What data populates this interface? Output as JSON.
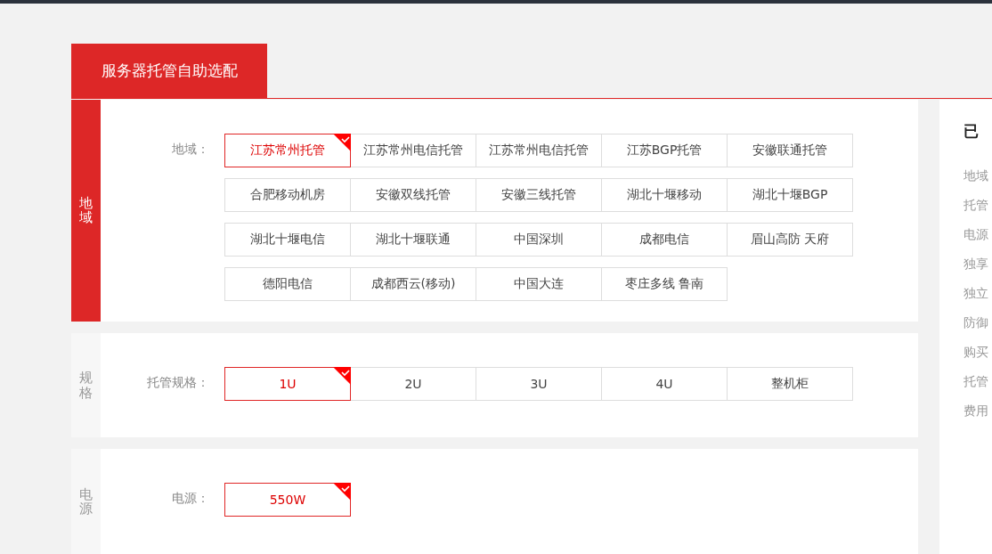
{
  "header": {
    "title": "服务器托管自助选配"
  },
  "sections": [
    {
      "name": "地域",
      "active": true,
      "label": "地域：",
      "options": [
        {
          "label": "江苏常州托管",
          "selected": true
        },
        {
          "label": "江苏常州电信托管",
          "selected": false
        },
        {
          "label": "江苏常州电信托管",
          "selected": false
        },
        {
          "label": "江苏BGP托管",
          "selected": false
        },
        {
          "label": "安徽联通托管",
          "selected": false
        },
        {
          "label": "合肥移动机房",
          "selected": false
        },
        {
          "label": "安徽双线托管",
          "selected": false
        },
        {
          "label": "安徽三线托管",
          "selected": false
        },
        {
          "label": "湖北十堰移动",
          "selected": false
        },
        {
          "label": "湖北十堰BGP",
          "selected": false
        },
        {
          "label": "湖北十堰电信",
          "selected": false
        },
        {
          "label": "湖北十堰联通",
          "selected": false
        },
        {
          "label": "中国深圳",
          "selected": false
        },
        {
          "label": "成都电信",
          "selected": false
        },
        {
          "label": "眉山高防 天府",
          "selected": false
        },
        {
          "label": "德阳电信",
          "selected": false
        },
        {
          "label": "成都西云(移动)",
          "selected": false
        },
        {
          "label": "中国大连",
          "selected": false
        },
        {
          "label": "枣庄多线 鲁南",
          "selected": false
        }
      ]
    },
    {
      "name": "规格",
      "active": false,
      "label": "托管规格：",
      "options": [
        {
          "label": "1U",
          "selected": true
        },
        {
          "label": "2U",
          "selected": false
        },
        {
          "label": "3U",
          "selected": false
        },
        {
          "label": "4U",
          "selected": false
        },
        {
          "label": "整机柜",
          "selected": false
        }
      ]
    },
    {
      "name": "电源",
      "active": false,
      "label": "电源：",
      "options": [
        {
          "label": "550W",
          "selected": true
        }
      ]
    }
  ],
  "summary": {
    "title": "已",
    "items": [
      "地域",
      "托管",
      "电源",
      "独享",
      "独立",
      "防御",
      "购买",
      "托管",
      "费用"
    ]
  }
}
